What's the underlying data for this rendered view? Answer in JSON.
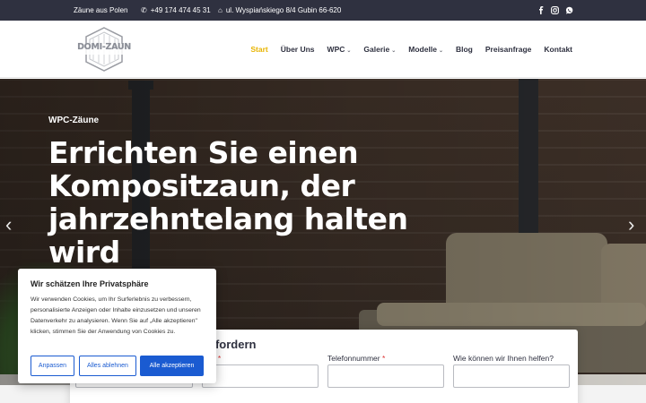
{
  "topbar": {
    "location": "Zäune aus Polen",
    "phone": "+49 174 474 45 31",
    "address": "ul. Wyspiańskiego 8/4 Gubin 66-620",
    "social": [
      "facebook-icon",
      "instagram-icon",
      "whatsapp-icon"
    ]
  },
  "header": {
    "logo_text": "DOMI-ZAUN",
    "nav": [
      {
        "label": "Start",
        "active": true,
        "dropdown": false
      },
      {
        "label": "Über Uns",
        "active": false,
        "dropdown": false
      },
      {
        "label": "WPC",
        "active": false,
        "dropdown": true
      },
      {
        "label": "Galerie",
        "active": false,
        "dropdown": true
      },
      {
        "label": "Modelle",
        "active": false,
        "dropdown": true
      },
      {
        "label": "Blog",
        "active": false,
        "dropdown": false
      },
      {
        "label": "Preisanfrage",
        "active": false,
        "dropdown": false
      },
      {
        "label": "Kontakt",
        "active": false,
        "dropdown": false
      }
    ]
  },
  "hero": {
    "kicker": "WPC-Zäune",
    "title": "Errichten Sie einen Kompositzaun, der jahrzehntelang halten wird"
  },
  "form": {
    "title_partial": "nfordern",
    "email_label": "ail",
    "phone_label": "Telefonnummer",
    "help_label": "Wie können wir Ihnen helfen?",
    "required_mark": "*"
  },
  "cookie": {
    "title": "Wir schätzen Ihre Privatsphäre",
    "text": "Wir verwenden Cookies, um Ihr Surferlebnis zu verbessern, personalisierte Anzeigen oder Inhalte einzusetzen und unseren Datenverkehr zu analysieren. Wenn Sie auf „Alle akzeptieren\" klicken, stimmen Sie der Anwendung von Cookies zu.",
    "btn_customize": "Anpassen",
    "btn_reject": "Alles ablehnen",
    "btn_accept": "Alle akzeptieren"
  },
  "colors": {
    "topbar_bg": "#2f3140",
    "nav_active": "#e8b400",
    "cookie_accent": "#1a5bd1"
  }
}
